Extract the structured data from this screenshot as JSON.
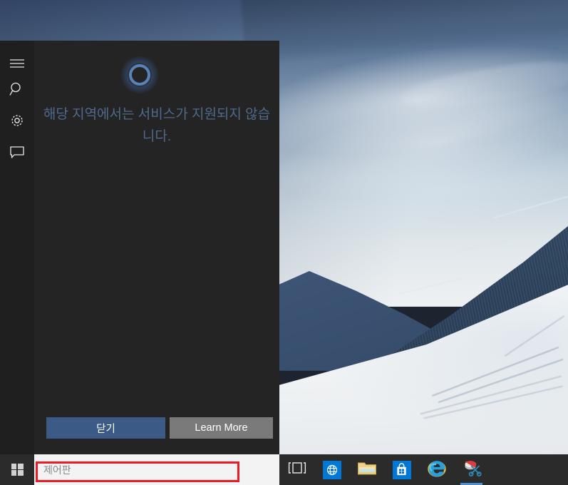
{
  "desktop": {
    "wallpaper_description": "winter mountain landscape with snowfield and ski tracks"
  },
  "cortana": {
    "ring_icon": "cortana-ring-icon",
    "message": "해당 지역에서는 서비스가 지원되지 않습니다.",
    "rail": [
      {
        "icon": "hamburger-menu-icon",
        "name": "menu"
      },
      {
        "icon": "search-icon",
        "name": "search"
      },
      {
        "icon": "gear-icon",
        "name": "settings"
      },
      {
        "icon": "feedback-icon",
        "name": "feedback"
      }
    ],
    "buttons": {
      "close_label": "닫기",
      "learn_more_label": "Learn More"
    },
    "colors": {
      "panel_bg": "#242424",
      "rail_bg": "#1f1f1f",
      "message_text": "#4f6a8c",
      "close_button": "#3b5a85",
      "learn_more_button": "#7a7a7a",
      "ring_stroke": "#5b82b8"
    }
  },
  "taskbar": {
    "start_icon": "windows-logo-icon",
    "search": {
      "value": "제어판",
      "placeholder": "제어판"
    },
    "items": [
      {
        "name": "task-view",
        "icon": "task-view-icon",
        "label": "Task View",
        "active": false
      },
      {
        "name": "edge",
        "icon": "edge-browser-icon",
        "label": "Microsoft Edge",
        "active": false
      },
      {
        "name": "file-explorer",
        "icon": "folder-icon",
        "label": "File Explorer",
        "active": false
      },
      {
        "name": "microsoft-store",
        "icon": "store-bag-icon",
        "label": "Microsoft Store",
        "active": false
      },
      {
        "name": "internet-explorer",
        "icon": "internet-explorer-icon",
        "label": "Internet Explorer",
        "active": false
      },
      {
        "name": "snipping-tool",
        "icon": "scissors-icon",
        "label": "Snipping Tool",
        "active": true
      }
    ],
    "colors": {
      "bg": "#2b2b2b",
      "search_bg": "#f3f3f3",
      "search_text": "#8a8a8a",
      "accent": "#0078d7",
      "active_indicator": "#4a90d9"
    }
  },
  "annotation": {
    "highlight_color": "#ec1c24",
    "target": "taskbar-search-box"
  }
}
